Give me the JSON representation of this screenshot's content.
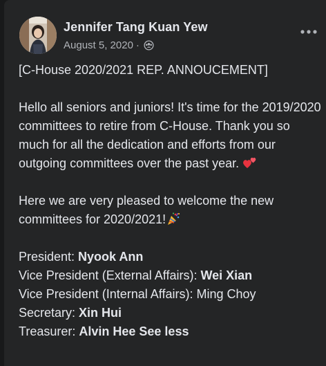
{
  "post": {
    "author": "Jennifer Tang Kuan Yew",
    "date": "August 5, 2020",
    "meta_separator": "·",
    "audience_icon": "friends-icon",
    "more_icon": "more-options-icon",
    "headline": "[C-House 2020/2021 REP. ANNOUCEMENT]",
    "paragraph1": "Hello all seniors and juniors! It's time for the 2019/2020 committees to retire from C-House. Thank you so much for all the dedication and efforts from our outgoing committees over the past year.",
    "paragraph1_emoji": "two-hearts-emoji",
    "paragraph2": "Here we are very pleased to welcome the new committees for 2020/2021!",
    "paragraph2_emoji": "party-popper-emoji",
    "roles": [
      {
        "title": "President: ",
        "name": "Nyook Ann",
        "bold": true
      },
      {
        "title": "Vice President (External Affairs): ",
        "name": "Wei Xian",
        "bold": true
      },
      {
        "title": "Vice President (Internal Affairs): ",
        "name": "Ming Choy",
        "bold": false
      },
      {
        "title": "Secretary: ",
        "name": "Xin Hui",
        "bold": true
      },
      {
        "title": "Treasurer: ",
        "name": "Alvin Hee",
        "bold": true
      }
    ],
    "see_less_label": "See less"
  },
  "colors": {
    "card_background": "#242526",
    "page_background": "#18191a",
    "primary_text": "#e4e6eb",
    "secondary_text": "#b0b3b8"
  }
}
